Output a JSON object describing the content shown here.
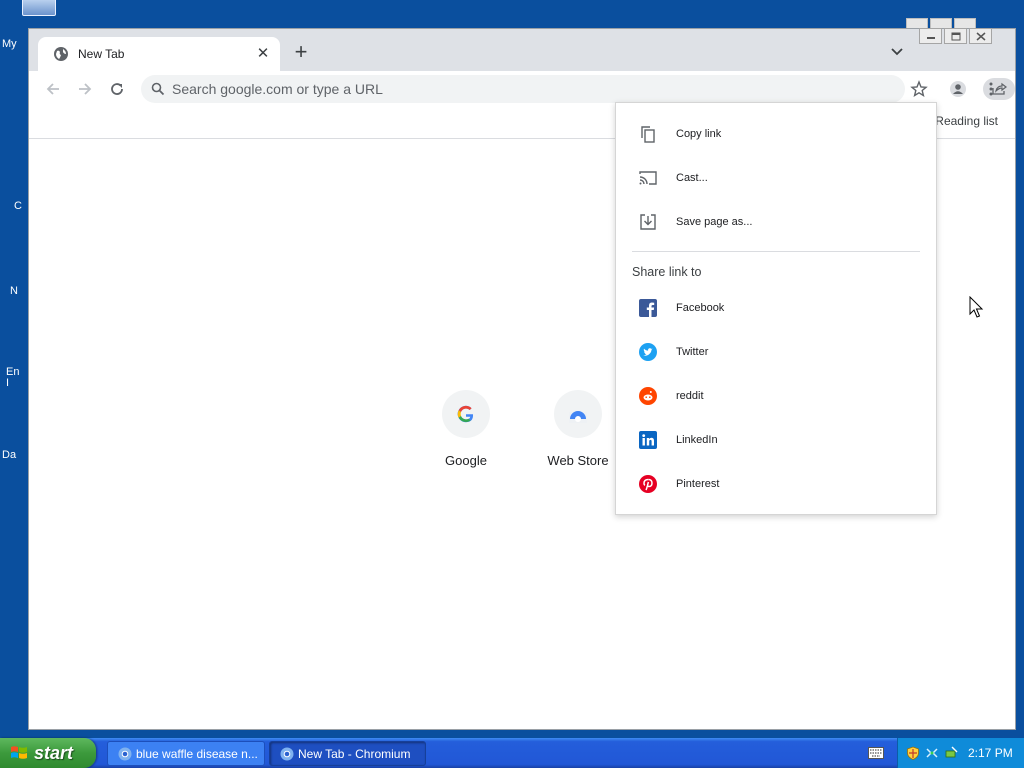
{
  "desktop": {
    "labels": [
      "My",
      "C",
      "N",
      "En\nI",
      "Da"
    ]
  },
  "browser": {
    "tab": {
      "title": "New Tab",
      "close_icon": "close-icon"
    },
    "toolbar": {
      "omnibox_placeholder": "Search google.com or type a URL"
    },
    "bookmarks": {
      "reading_list": "Reading list"
    },
    "shortcuts": [
      {
        "label": "Google",
        "icon": "google-icon"
      },
      {
        "label": "Web Store",
        "icon": "web-store-icon"
      }
    ],
    "share_menu": {
      "items": [
        {
          "label": "Copy link",
          "icon": "copy-icon"
        },
        {
          "label": "Cast...",
          "icon": "cast-icon"
        },
        {
          "label": "Save page as...",
          "icon": "save-icon"
        }
      ],
      "share_heading": "Share link to",
      "targets": [
        {
          "label": "Facebook",
          "icon": "facebook-icon",
          "color": "#3b5998"
        },
        {
          "label": "Twitter",
          "icon": "twitter-icon",
          "color": "#1da1f2"
        },
        {
          "label": "reddit",
          "icon": "reddit-icon",
          "color": "#ff4500"
        },
        {
          "label": "LinkedIn",
          "icon": "linkedin-icon",
          "color": "#0a66c2"
        },
        {
          "label": "Pinterest",
          "icon": "pinterest-icon",
          "color": "#e60023"
        }
      ]
    }
  },
  "taskbar": {
    "start_label": "start",
    "tasks": [
      {
        "label": "blue waffle disease n...",
        "active": false
      },
      {
        "label": "New Tab - Chromium",
        "active": true
      }
    ],
    "clock": "2:17 PM"
  }
}
